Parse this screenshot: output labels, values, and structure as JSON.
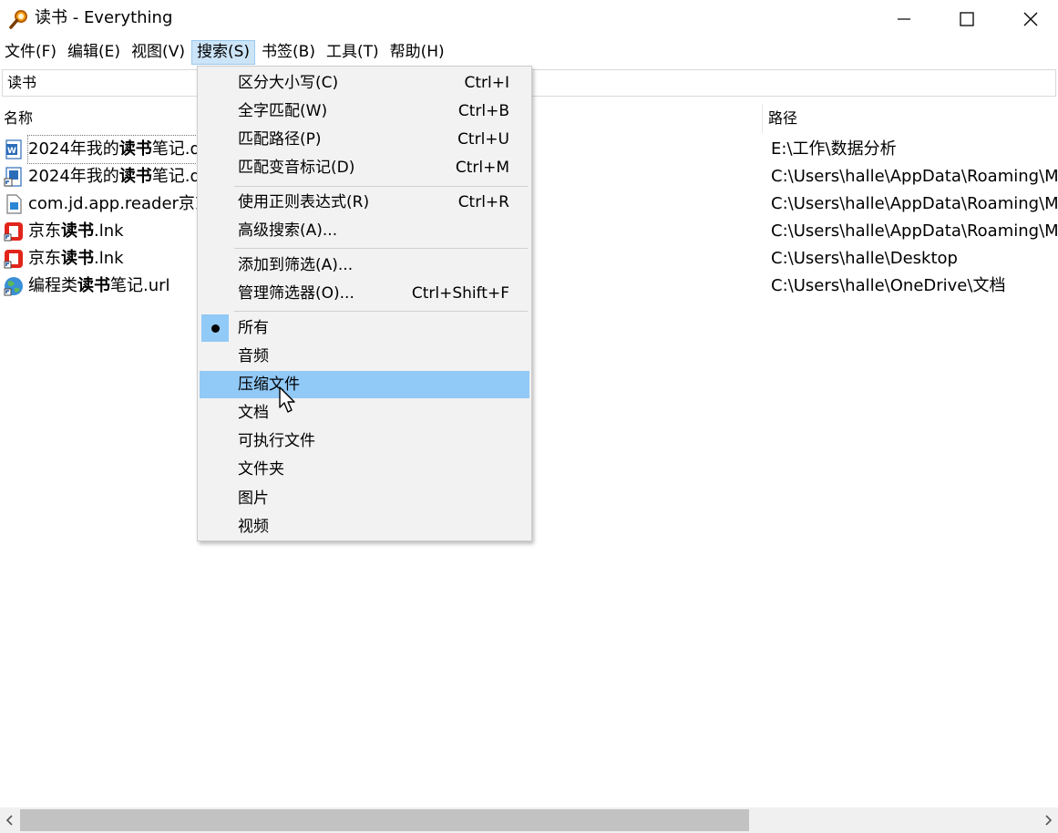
{
  "window": {
    "title": "读书 - Everything",
    "icon": "magnifier-icon"
  },
  "menu": [
    "文件(F)",
    "编辑(E)",
    "视图(V)",
    "搜索(S)",
    "书签(B)",
    "工具(T)",
    "帮助(H)"
  ],
  "search": {
    "value": "读书"
  },
  "columns": {
    "name": "名称",
    "path": "路径"
  },
  "rows": [
    {
      "pre": "2024年我的",
      "bold": "读书",
      "post": "笔记.d",
      "path": "E:\\工作\\数据分析",
      "icon": "word-doc-icon"
    },
    {
      "pre": "2024年我的",
      "bold": "读书",
      "post": "笔记.d",
      "path": "C:\\Users\\halle\\AppData\\Roaming\\Mi",
      "icon": "word-shortcut-icon"
    },
    {
      "pre": "com.jd.app.reader京东",
      "bold": "",
      "post": "",
      "path": "C:\\Users\\halle\\AppData\\Roaming\\MI",
      "icon": "file-icon"
    },
    {
      "pre": "京东",
      "bold": "读书",
      "post": ".lnk",
      "path": "C:\\Users\\halle\\AppData\\Roaming\\Mi",
      "icon": "jd-reader-icon"
    },
    {
      "pre": "京东",
      "bold": "读书",
      "post": ".lnk",
      "path": "C:\\Users\\halle\\Desktop",
      "icon": "jd-reader-icon"
    },
    {
      "pre": "编程类",
      "bold": "读书",
      "post": "笔记.url",
      "path": "C:\\Users\\halle\\OneDrive\\文档",
      "icon": "globe-icon"
    }
  ],
  "dropdown": {
    "group1": [
      {
        "label": "区分大小写(C)",
        "shortcut": "Ctrl+I"
      },
      {
        "label": "全字匹配(W)",
        "shortcut": "Ctrl+B"
      },
      {
        "label": "匹配路径(P)",
        "shortcut": "Ctrl+U"
      },
      {
        "label": "匹配变音标记(D)",
        "shortcut": "Ctrl+M"
      }
    ],
    "group2": [
      {
        "label": "使用正则表达式(R)",
        "shortcut": "Ctrl+R"
      },
      {
        "label": "高级搜索(A)...",
        "shortcut": ""
      }
    ],
    "group3": [
      {
        "label": "添加到筛选(A)...",
        "shortcut": ""
      },
      {
        "label": "管理筛选器(O)...",
        "shortcut": "Ctrl+Shift+F"
      }
    ],
    "filters": [
      "所有",
      "音频",
      "压缩文件",
      "文档",
      "可执行文件",
      "文件夹",
      "图片",
      "视频"
    ],
    "checked_filter": "所有",
    "hovered_filter": "压缩文件"
  },
  "colors": {
    "menu_highlight": "#91c9f7",
    "menu_active": "#cce4f7",
    "scroll_thumb": "#c2c2c2"
  }
}
